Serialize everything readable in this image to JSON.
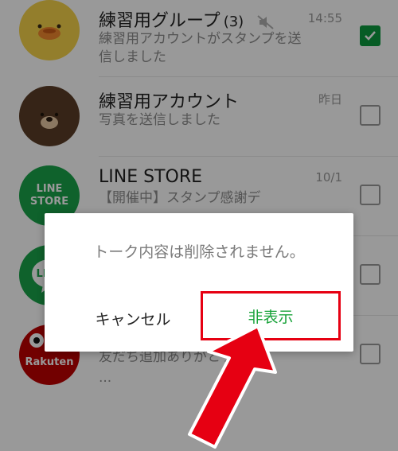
{
  "chat_list": {
    "rows": [
      {
        "name": "練習用グループ",
        "count": "(3)",
        "preview": "練習用アカウントがスタンプを送信しました",
        "time": "14:55",
        "muted": true,
        "checked": true,
        "avatar": "brown-bear-duck-icon"
      },
      {
        "name": "練習用アカウント",
        "preview": "写真を送信しました",
        "time": "昨日",
        "checked": false,
        "avatar": "brown-bear-icon"
      },
      {
        "name": "LINE STORE",
        "preview": "【開催中】スタンプ感謝デ",
        "time": "10/1",
        "checked": false,
        "avatar": "line-store-logo",
        "avatar_text_1": "LINE",
        "avatar_text_2": "STORE"
      },
      {
        "name": "",
        "preview": "",
        "time": "",
        "checked": false,
        "avatar": "line-logo",
        "avatar_text": "LINE"
      },
      {
        "name": "",
        "preview": "友だち追加ありがとう！",
        "preview_extra": "...",
        "time": "",
        "checked": false,
        "avatar": "rakuten-logo",
        "avatar_text": "Rakuten"
      }
    ]
  },
  "dialog": {
    "message": "トーク内容は削除されません。",
    "cancel_label": "キャンセル",
    "hide_label": "非表示"
  },
  "colors": {
    "accent_green": "#0c9a3f",
    "hide_text": "#19a33a",
    "highlight_red": "#e60012"
  }
}
